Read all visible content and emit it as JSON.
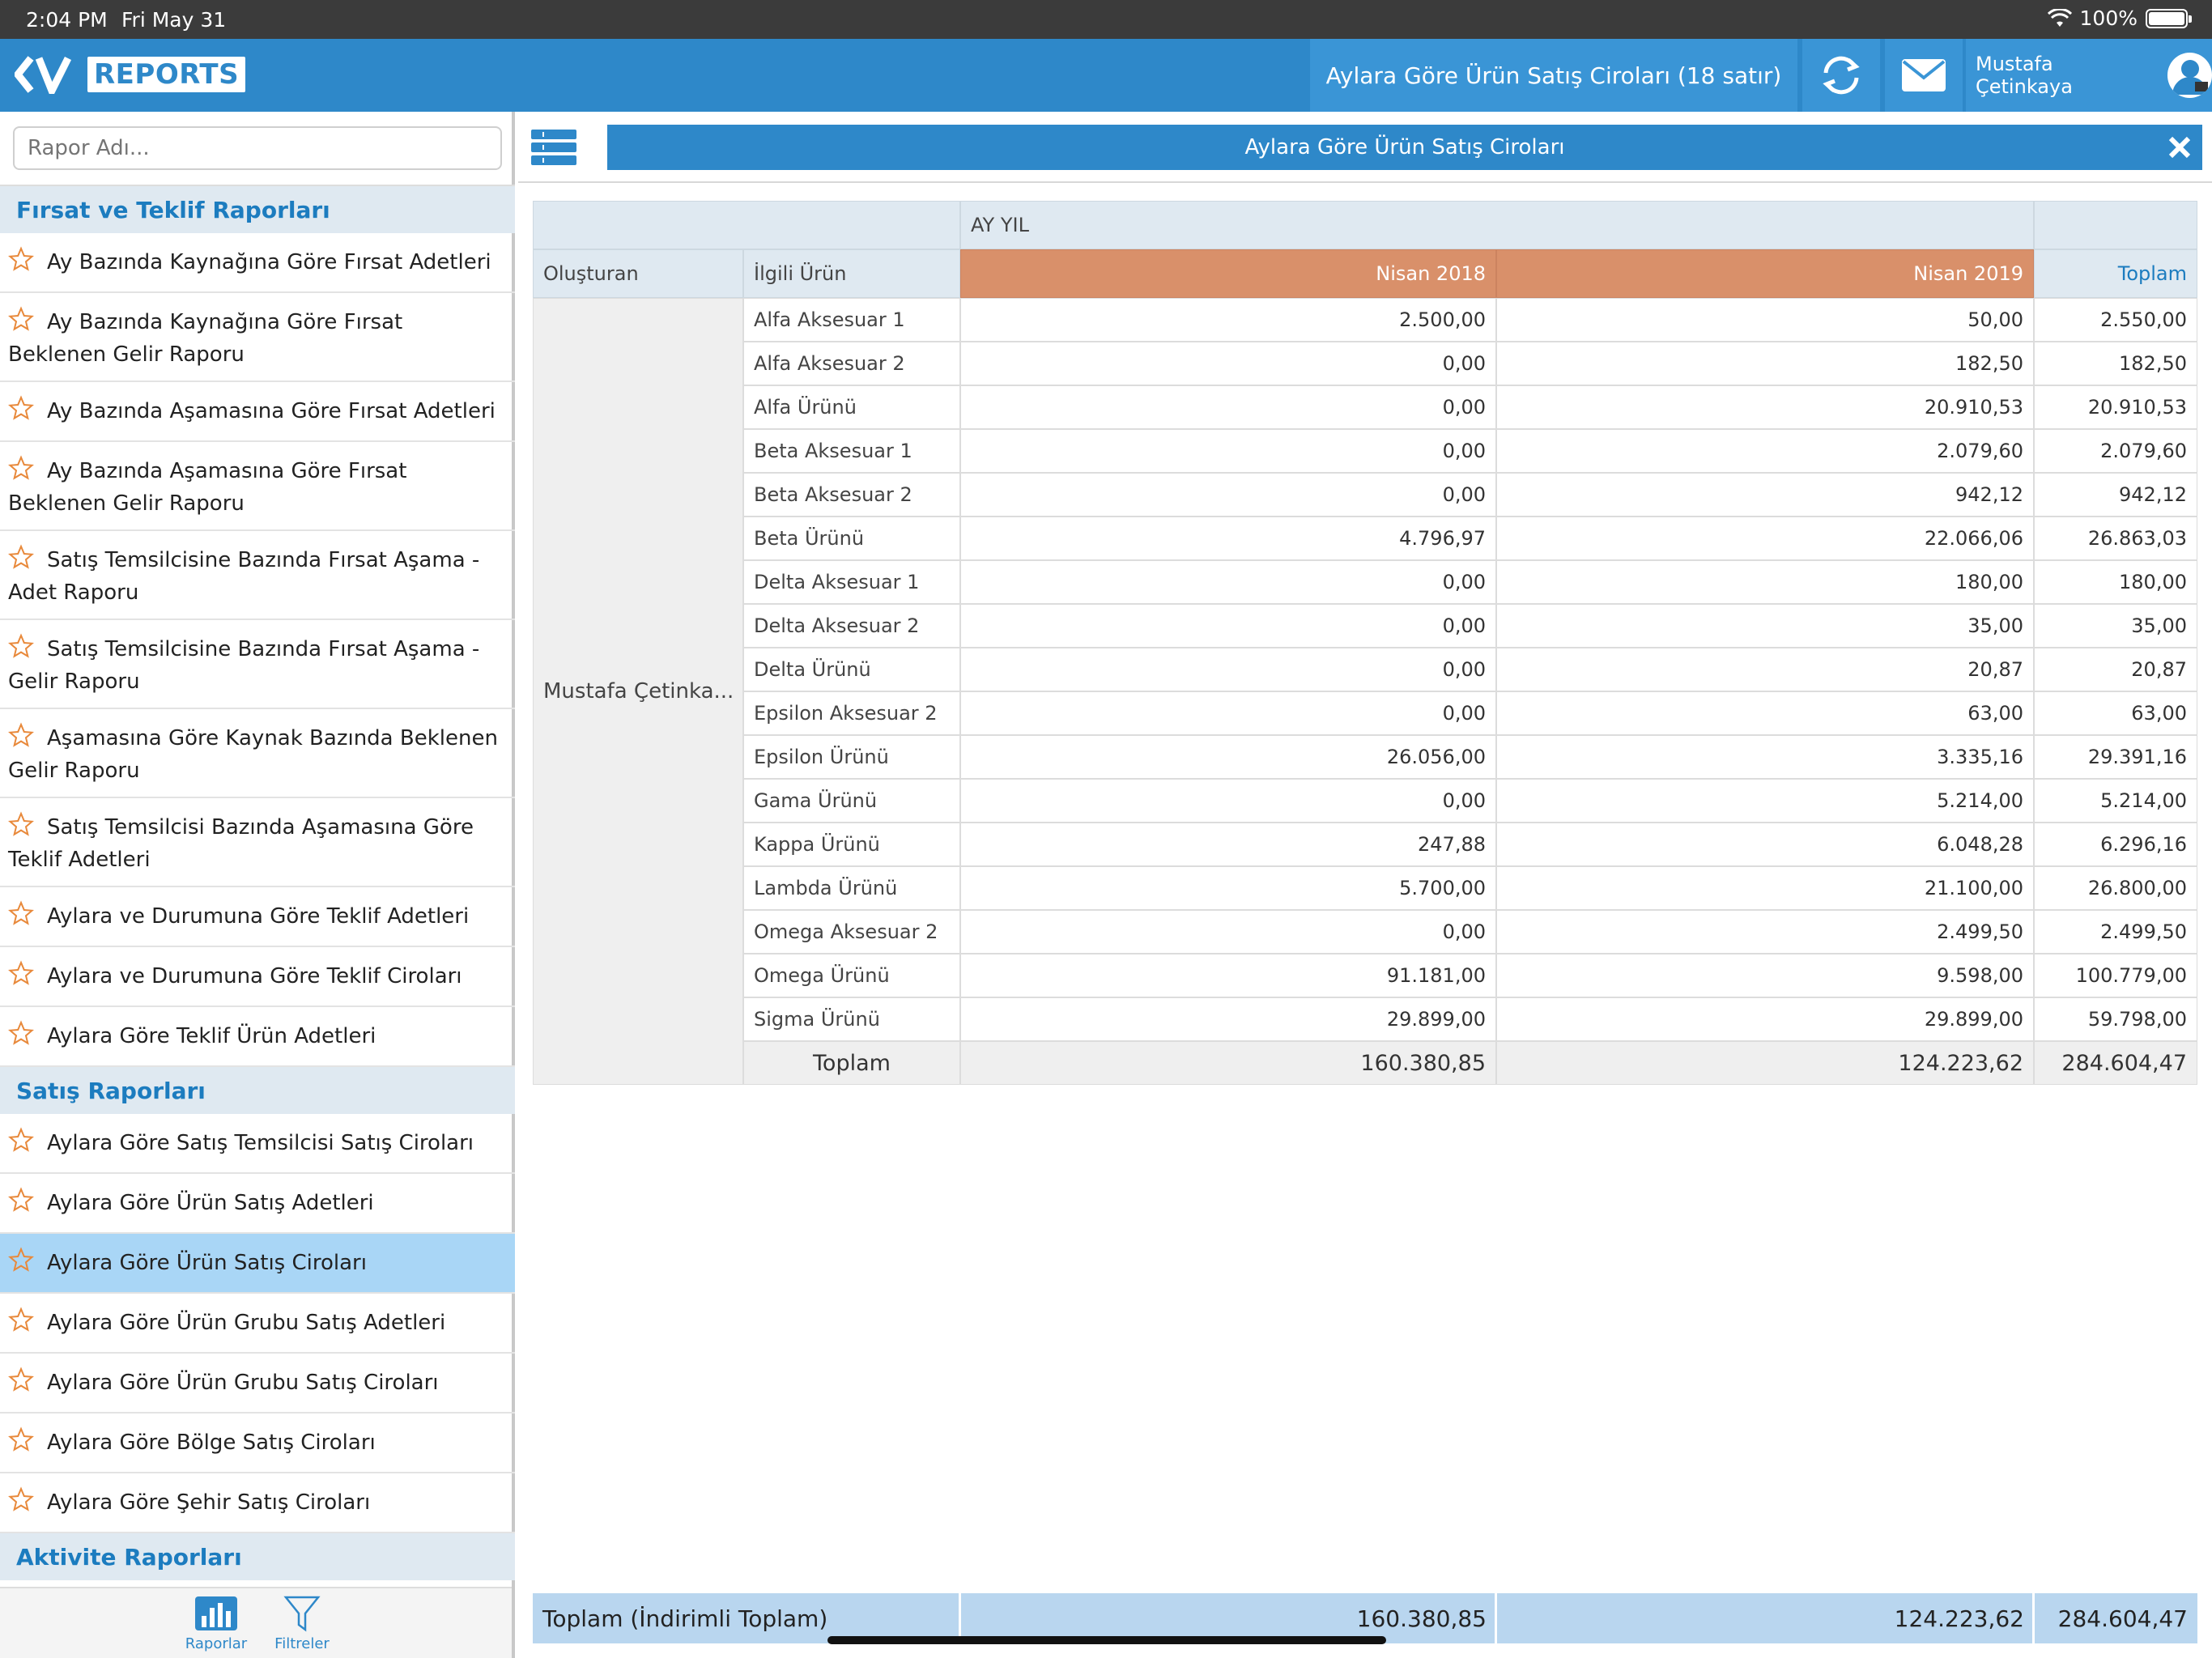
{
  "status_bar": {
    "time": "2:04 PM",
    "date": "Fri May 31",
    "battery": "100%"
  },
  "header": {
    "logo_text": "REPORTS",
    "report_title": "Aylara Göre Ürün Satış Ciroları (18 satır)",
    "user_name": "Mustafa Çetinkaya"
  },
  "sidebar": {
    "search_placeholder": "Rapor Adı...",
    "sections": [
      {
        "title": "Fırsat ve Teklif Raporları",
        "items": [
          "Ay Bazında Kaynağına Göre Fırsat Adetleri",
          "Ay Bazında Kaynağına Göre Fırsat Beklenen Gelir Raporu",
          "Ay Bazında Aşamasına Göre Fırsat Adetleri",
          "Ay Bazında Aşamasına Göre Fırsat Beklenen Gelir Raporu",
          "Satış Temsilcisine Bazında Fırsat Aşama - Adet Raporu",
          "Satış Temsilcisine Bazında Fırsat Aşama - Gelir Raporu",
          "Aşamasına Göre Kaynak Bazında Beklenen Gelir Raporu",
          "Satış Temsilcisi Bazında Aşamasına Göre Teklif Adetleri",
          "Aylara ve Durumuna Göre Teklif Adetleri",
          "Aylara ve Durumuna Göre Teklif Ciroları",
          "Aylara Göre Teklif Ürün Adetleri"
        ]
      },
      {
        "title": "Satış Raporları",
        "items": [
          "Aylara Göre Satış Temsilcisi Satış Ciroları",
          "Aylara Göre Ürün Satış Adetleri",
          "Aylara Göre Ürün Satış Ciroları",
          "Aylara Göre Ürün Grubu Satış Adetleri",
          "Aylara Göre Ürün Grubu Satış Ciroları",
          "Aylara Göre Bölge Satış Ciroları",
          "Aylara Göre Şehir Satış Ciroları"
        ]
      },
      {
        "title": "Aktivite Raporları",
        "items": []
      }
    ],
    "active_item": "Aylara Göre Ürün Satış Ciroları",
    "tabs": {
      "reports": "Raporlar",
      "filters": "Filtreler"
    }
  },
  "main": {
    "panel_title": "Aylara Göre Ürün Satış Ciroları",
    "pivot": {
      "column_group_label": "AY YIL",
      "row_headers": [
        "Oluşturan",
        "İlgili Ürün"
      ],
      "columns": [
        "Nisan 2018",
        "Nisan 2019"
      ],
      "total_label": "Toplam",
      "owner": "Mustafa Çetinka...",
      "rows": [
        {
          "product": "Alfa Aksesuar 1",
          "v2018": "2.500,00",
          "v2019": "50,00",
          "total": "2.550,00"
        },
        {
          "product": "Alfa Aksesuar 2",
          "v2018": "0,00",
          "v2019": "182,50",
          "total": "182,50"
        },
        {
          "product": "Alfa Ürünü",
          "v2018": "0,00",
          "v2019": "20.910,53",
          "total": "20.910,53"
        },
        {
          "product": "Beta Aksesuar 1",
          "v2018": "0,00",
          "v2019": "2.079,60",
          "total": "2.079,60"
        },
        {
          "product": "Beta Aksesuar 2",
          "v2018": "0,00",
          "v2019": "942,12",
          "total": "942,12"
        },
        {
          "product": "Beta Ürünü",
          "v2018": "4.796,97",
          "v2019": "22.066,06",
          "total": "26.863,03"
        },
        {
          "product": "Delta Aksesuar 1",
          "v2018": "0,00",
          "v2019": "180,00",
          "total": "180,00"
        },
        {
          "product": "Delta Aksesuar 2",
          "v2018": "0,00",
          "v2019": "35,00",
          "total": "35,00"
        },
        {
          "product": "Delta Ürünü",
          "v2018": "0,00",
          "v2019": "20,87",
          "total": "20,87"
        },
        {
          "product": "Epsilon Aksesuar 2",
          "v2018": "0,00",
          "v2019": "63,00",
          "total": "63,00"
        },
        {
          "product": "Epsilon Ürünü",
          "v2018": "26.056,00",
          "v2019": "3.335,16",
          "total": "29.391,16"
        },
        {
          "product": "Gama Ürünü",
          "v2018": "0,00",
          "v2019": "5.214,00",
          "total": "5.214,00"
        },
        {
          "product": "Kappa Ürünü",
          "v2018": "247,88",
          "v2019": "6.048,28",
          "total": "6.296,16"
        },
        {
          "product": "Lambda Ürünü",
          "v2018": "5.700,00",
          "v2019": "21.100,00",
          "total": "26.800,00"
        },
        {
          "product": "Omega Aksesuar 2",
          "v2018": "0,00",
          "v2019": "2.499,50",
          "total": "2.499,50"
        },
        {
          "product": "Omega Ürünü",
          "v2018": "91.181,00",
          "v2019": "9.598,00",
          "total": "100.779,00"
        },
        {
          "product": "Sigma Ürünü",
          "v2018": "29.899,00",
          "v2019": "29.899,00",
          "total": "59.798,00"
        }
      ],
      "subtotal": {
        "label": "Toplam",
        "v2018": "160.380,85",
        "v2019": "124.223,62",
        "total": "284.604,47"
      }
    },
    "footer": {
      "label": "Toplam (İndirimli Toplam)",
      "v2018": "160.380,85",
      "v2019": "124.223,62",
      "total": "284.604,47"
    }
  },
  "colors": {
    "primary": "#2e88c9",
    "header_cell": "#d9906a",
    "active_item": "#a9d6f6",
    "section_bg": "#dfe9f1"
  }
}
